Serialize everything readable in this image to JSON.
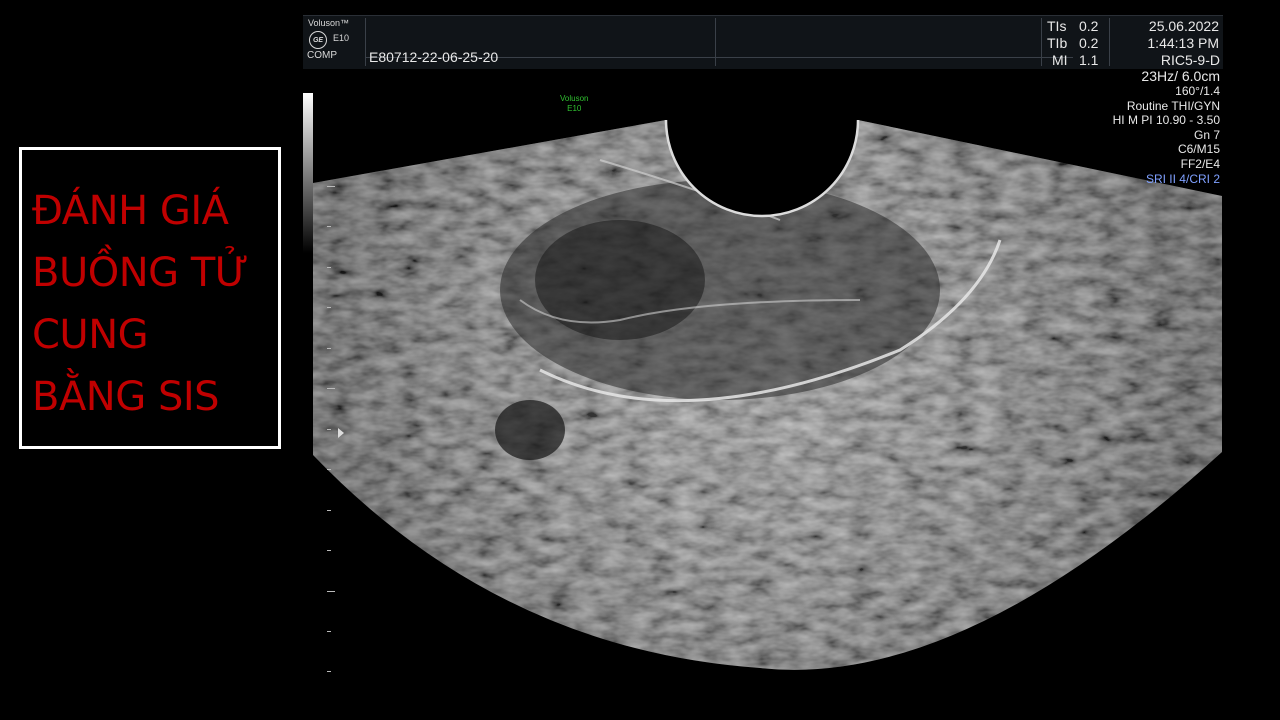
{
  "title": {
    "lines": [
      "ĐÁNH GIÁ",
      "BUỒNG TỬ",
      "CUNG",
      "BẰNG SIS"
    ],
    "color": "#c00000"
  },
  "header": {
    "brand": "Voluson™",
    "model": "E10",
    "logo_text": "GE",
    "comp_label": "COMP",
    "patient_id": "E80712-22-06-25-20",
    "tis_label": "TIs",
    "tis_value": "0.2",
    "tib_label": "TIb",
    "tib_value": "0.2",
    "mi_label": "MI",
    "mi_value": "1.1",
    "date": "25.06.2022",
    "time": "1:44:13 PM"
  },
  "probe_label": {
    "line1": "Voluson",
    "line2": "E10"
  },
  "image_info": {
    "probe": "RIC5-9-D",
    "freq_depth": "23Hz/ 6.0cm",
    "angle": "160°/1.4",
    "preset": "Routine THI/GYN",
    "power": "HI M PI 10.90 - 3.50",
    "gain": "Gn  7",
    "c_m": "C6/M15",
    "ff_e": "FF2/E4",
    "sri": "SRI II 4/CRI 2"
  },
  "colors": {
    "background": "#000000",
    "header_bg": "#101418",
    "sri_text": "#7fa0ff",
    "probe_label": "#30c030"
  }
}
